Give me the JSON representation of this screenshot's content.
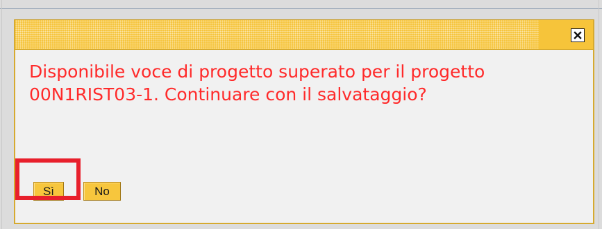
{
  "dialog": {
    "message": "Disponibile voce di progetto superato per il progetto 00N1RIST03-1. Continuare con il salvataggio?",
    "close_icon": "close-icon",
    "buttons": {
      "yes_label": "Sì",
      "no_label": "No"
    }
  },
  "colors": {
    "titlebar": "#f6c43a",
    "message_text": "#ff2a2a",
    "button_bg": "#f7c63d",
    "highlight": "#e8202c"
  }
}
